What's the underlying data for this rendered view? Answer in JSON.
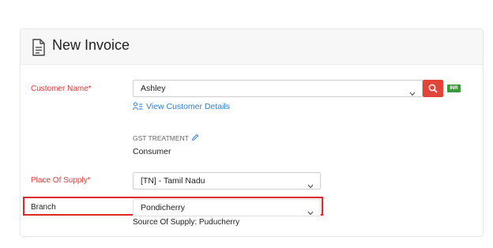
{
  "header": {
    "title": "New Invoice"
  },
  "customer": {
    "label": "Customer Name*",
    "value": "Ashley",
    "currency_badge": "INR",
    "view_details_link": "View Customer Details"
  },
  "gst": {
    "label": "GST TREATMENT",
    "value": "Consumer"
  },
  "place_of_supply": {
    "label": "Place Of Supply*",
    "value": "[TN] - Tamil Nadu"
  },
  "branch": {
    "label": "Branch",
    "value": "Pondicherry",
    "source_of_supply": "Source Of Supply: Puducherry"
  },
  "colors": {
    "required_label": "#e23a3a",
    "search_button": "#e2443a",
    "link": "#2a7fd4",
    "inr_badge": "#3a9a3a",
    "highlight_border": "#e02a2a"
  },
  "icons": {
    "header": "document-icon",
    "search": "search-icon",
    "view_details": "user-list-icon",
    "edit": "pencil-icon",
    "dropdown": "chevron-down-icon"
  }
}
